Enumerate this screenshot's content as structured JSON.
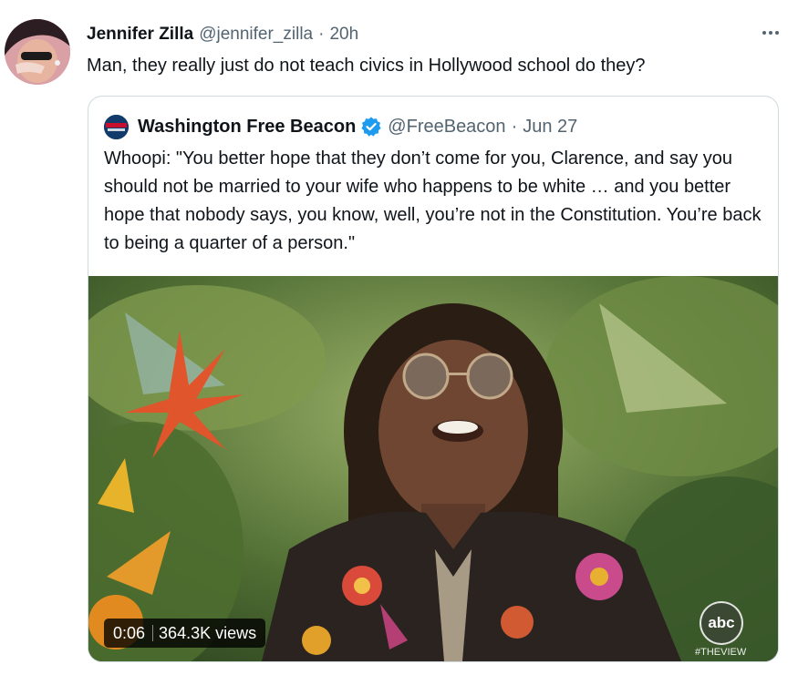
{
  "tweet": {
    "author_name": "Jennifer Zilla",
    "author_handle": "@jennifer_zilla",
    "separator": "·",
    "time": "20h",
    "text": "Man, they really just do not teach civics in Hollywood school do they?"
  },
  "quoted_tweet": {
    "author_name": "Washington Free Beacon",
    "author_handle": "@FreeBeacon",
    "separator": "·",
    "date": "Jun 27",
    "verified": true,
    "text": "Whoopi: \"You better hope that they don’t come for you, Clarence, and say you should not be married to your wife who happens to be white … and you better hope that nobody says, you know, well, you’re not in the Constitution. You’re back to being a quarter of a person.\"",
    "video": {
      "duration": "0:06",
      "views": "364.3K views",
      "network_logo": "abc",
      "hashtag": "#THEVIEW"
    }
  },
  "colors": {
    "text_primary": "#0f1419",
    "text_secondary": "#536471",
    "verified_blue": "#1d9bf0",
    "border": "#cfd9de"
  },
  "icons": {
    "more": "more-horizontal-icon",
    "verified": "verified-badge-icon"
  }
}
